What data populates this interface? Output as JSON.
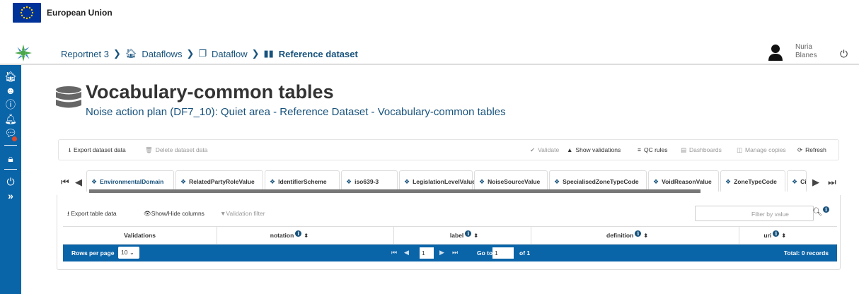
{
  "eu": {
    "label": "European Union"
  },
  "breadcrumb": [
    {
      "label": "Reportnet 3",
      "icon": "none"
    },
    {
      "label": "Dataflows",
      "icon": "home-icon"
    },
    {
      "label": "Dataflow",
      "icon": "clone-icon"
    },
    {
      "label": "Reference dataset",
      "icon": "book-icon"
    }
  ],
  "user": {
    "first": "Nuria",
    "last": "Blanes"
  },
  "page": {
    "title": "Vocabulary-common tables",
    "subtitle": "Noise action plan (DF7_10): Quiet area - Reference Dataset - Vocabulary-common tables"
  },
  "toolbar": {
    "export_dataset": "Export dataset data",
    "delete_dataset": "Delete dataset data",
    "validate": "Validate",
    "show_validations": "Show validations",
    "qc_rules": "QC rules",
    "dashboards": "Dashboards",
    "manage_copies": "Manage copies",
    "refresh": "Refresh"
  },
  "tabs": [
    "EnvironmentalDomain",
    "RelatedPartyRoleValue",
    "IdentifierScheme",
    "iso639-3",
    "LegislationLevelValue",
    "NoiseSourceValue",
    "SpecialisedZoneTypeCode",
    "VoidReasonValue",
    "ZoneTypeCode",
    "Ci"
  ],
  "table": {
    "export_table": "Export table data",
    "show_hide_columns": "Show/Hide columns",
    "validation_filter": "Validation filter",
    "filter_placeholder": "Filter by value",
    "columns": [
      "Validations",
      "notation",
      "label",
      "definition",
      "uri"
    ]
  },
  "paginator": {
    "rows_per_page_label": "Rows per page",
    "rows_per_page": "10",
    "current_page": "1",
    "goto_label": "Go to",
    "goto_value": "1",
    "of_label": "of 1",
    "total": "Total: 0 records"
  },
  "colors": {
    "primary": "#0a64a8",
    "link": "#17527c"
  }
}
